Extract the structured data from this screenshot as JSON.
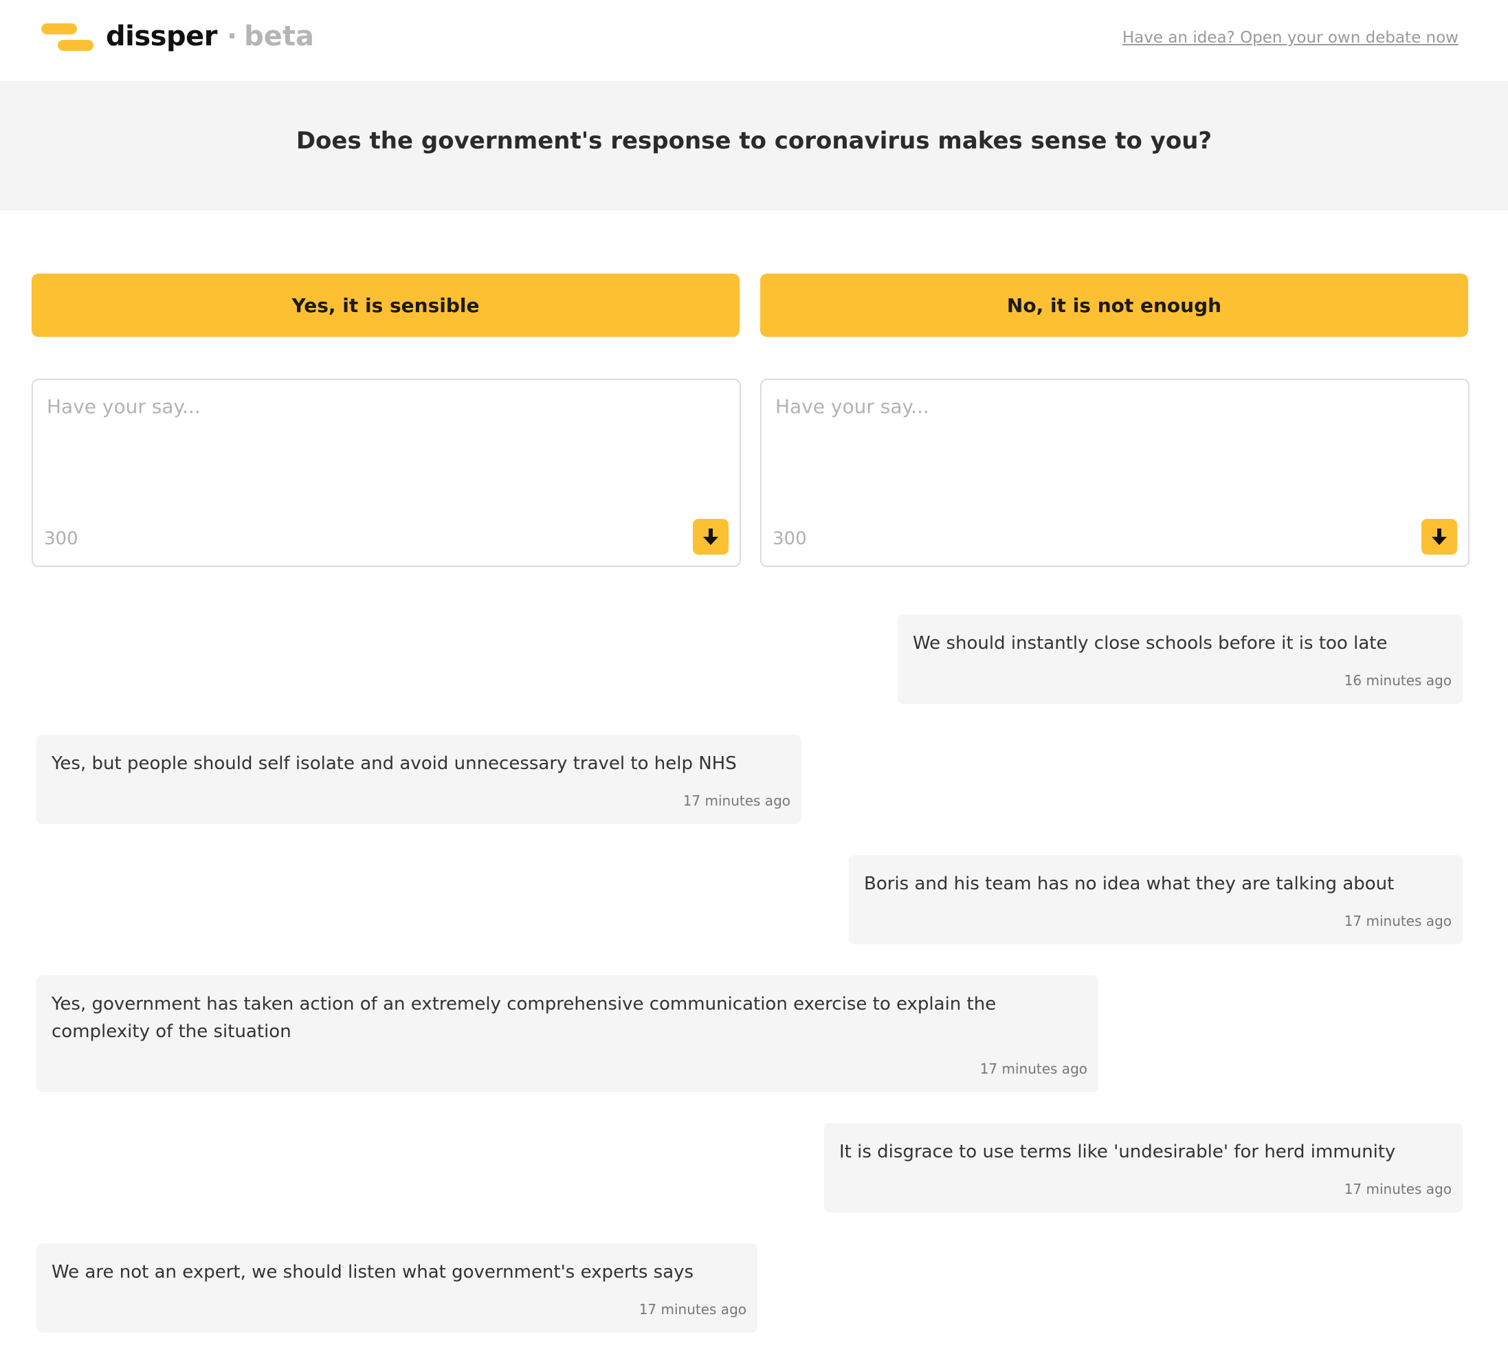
{
  "header": {
    "brand": "dissper",
    "separator": "·",
    "badge": "beta",
    "cta_link": "Have an idea? Open your own debate now",
    "brand_color": "#FDC032"
  },
  "debate": {
    "question": "Does the government's response to coronavirus makes sense to you?"
  },
  "sides": {
    "yes": {
      "label": "Yes, it is sensible",
      "placeholder": "Have your say...",
      "remaining": "300"
    },
    "no": {
      "label": "No, it is not enough",
      "placeholder": "Have your say...",
      "remaining": "300"
    }
  },
  "comments": [
    {
      "side": "no",
      "text": "We should instantly close schools before it is too late",
      "time": "16 minutes ago"
    },
    {
      "side": "yes",
      "text": "Yes, but people should self isolate and avoid unnecessary travel to help NHS",
      "time": "17 minutes ago"
    },
    {
      "side": "no",
      "text": "Boris and his team has no idea what they are talking about",
      "time": "17 minutes ago"
    },
    {
      "side": "yes",
      "text": "Yes, government has taken action of an extremely comprehensive communication exercise to explain the complexity of the situation",
      "time": "17 minutes ago"
    },
    {
      "side": "no",
      "text": "It is disgrace to use terms like 'undesirable' for herd immunity",
      "time": "17 minutes ago"
    },
    {
      "side": "yes",
      "text": "We are not an expert, we should listen what government's experts says",
      "time": "17 minutes ago"
    }
  ]
}
